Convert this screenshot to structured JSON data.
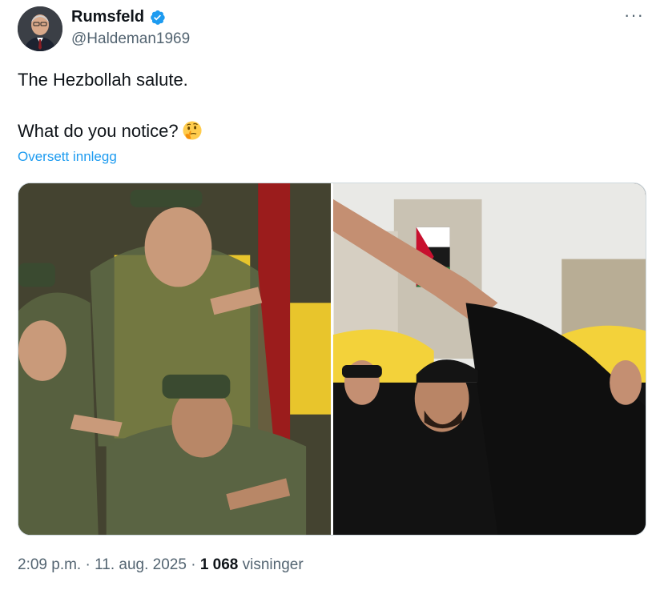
{
  "user": {
    "display_name": "Rumsfeld",
    "handle": "@Haldeman1969",
    "verified": true,
    "avatar_icon": "profile-photo"
  },
  "menu": {
    "more_label": "···"
  },
  "tweet": {
    "line1": "The Hezbollah salute.",
    "line2": "What do you notice?",
    "emoji": "thinking-face-icon",
    "translate_label": "Oversett innlegg"
  },
  "media": {
    "panels": 2,
    "left_description_icon": "photo-left",
    "right_description_icon": "photo-right"
  },
  "meta": {
    "time": "2:09 p.m.",
    "separator1": " · ",
    "date": "11. aug. 2025",
    "separator2": " · ",
    "views_count": "1 068",
    "views_label": " visninger"
  },
  "colors": {
    "link": "#1d9bf0",
    "verified": "#1d9bf0",
    "secondary_text": "#536471",
    "flag_yellow": "#f3d23a"
  }
}
